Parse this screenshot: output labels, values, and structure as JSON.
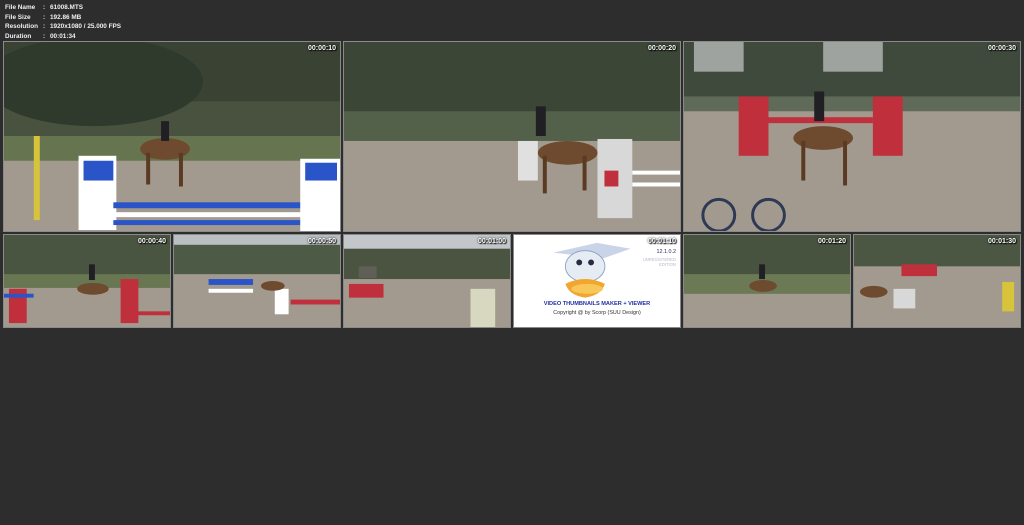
{
  "file_info": {
    "rows": [
      {
        "key": "File Name",
        "value": "61008.MTS"
      },
      {
        "key": "File Size",
        "value": "192.86 MB"
      },
      {
        "key": "Resolution",
        "value": "1920x1080 / 25.000 FPS"
      },
      {
        "key": "Duration",
        "value": "00:01:34"
      }
    ]
  },
  "thumbnails": [
    {
      "timestamp": "00:00:10"
    },
    {
      "timestamp": "00:00:20"
    },
    {
      "timestamp": "00:00:30"
    },
    {
      "timestamp": "00:00:40"
    },
    {
      "timestamp": "00:00:50"
    },
    {
      "timestamp": "00:01:00"
    },
    {
      "timestamp": "00:01:10"
    },
    {
      "timestamp": "00:01:20"
    },
    {
      "timestamp": "00:01:30"
    }
  ],
  "watermark": {
    "title": "VIDEO THUMBNAILS MAKER + VIEWER",
    "version": "12.1.0.2",
    "edition_line1": "UNREGISTERED",
    "edition_line2": "EDITION",
    "copyright": "Copyright @ by Scorp (SUU Design)"
  },
  "colors": {
    "background": "#2d2d2d",
    "arena_sand": "#a39a8f",
    "grass": "#5f7048",
    "trees": "#3c4636",
    "horse": "#6e4a2e",
    "jump_blue": "#2a55c8",
    "jump_red": "#c0303c",
    "logo_blue": "#1f2fa0"
  }
}
